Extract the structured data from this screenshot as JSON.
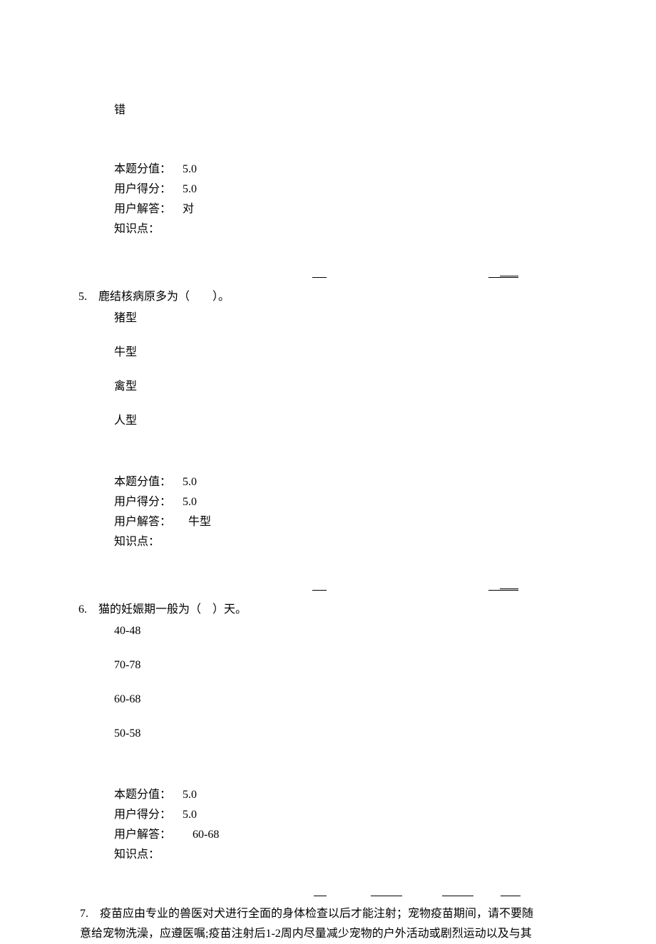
{
  "q4_remainder": {
    "answer_option": "错",
    "score": {
      "label_value": "本题分值：",
      "value": "5.0",
      "label_user_score": "用户得分：",
      "user_score": "5.0",
      "label_user_answer": "用户解答：",
      "user_answer": "对",
      "label_knowledge": "知识点："
    }
  },
  "q5": {
    "number": "5.",
    "text": "鹿结核病原多为（　　）。",
    "options": [
      "猪型",
      "牛型",
      "禽型",
      "人型"
    ],
    "score": {
      "label_value": "本题分值：",
      "value": "5.0",
      "label_user_score": "用户得分：",
      "user_score": "5.0",
      "label_user_answer": "用户解答：",
      "user_answer": "牛型",
      "label_knowledge": "知识点："
    }
  },
  "q6": {
    "number": "6.",
    "text": "猫的妊娠期一般为（　）天。",
    "options": [
      "40-48",
      "70-78",
      "60-68",
      "50-58"
    ],
    "score": {
      "label_value": "本题分值：",
      "value": "5.0",
      "label_user_score": "用户得分：",
      "user_score": "5.0",
      "label_user_answer": "用户解答：",
      "user_answer": "60-68",
      "label_knowledge": "知识点："
    }
  },
  "q7": {
    "number": "7.",
    "line1": "疫苗应由专业的兽医对犬进行全面的身体检查以后才能注射；宠物疫苗期间，请不要随",
    "line2": "意给宠物洗澡，应遵医嘱;疫苗注射后1-2周内尽量减少宠物的户外活动或剧烈运动以及与其"
  }
}
